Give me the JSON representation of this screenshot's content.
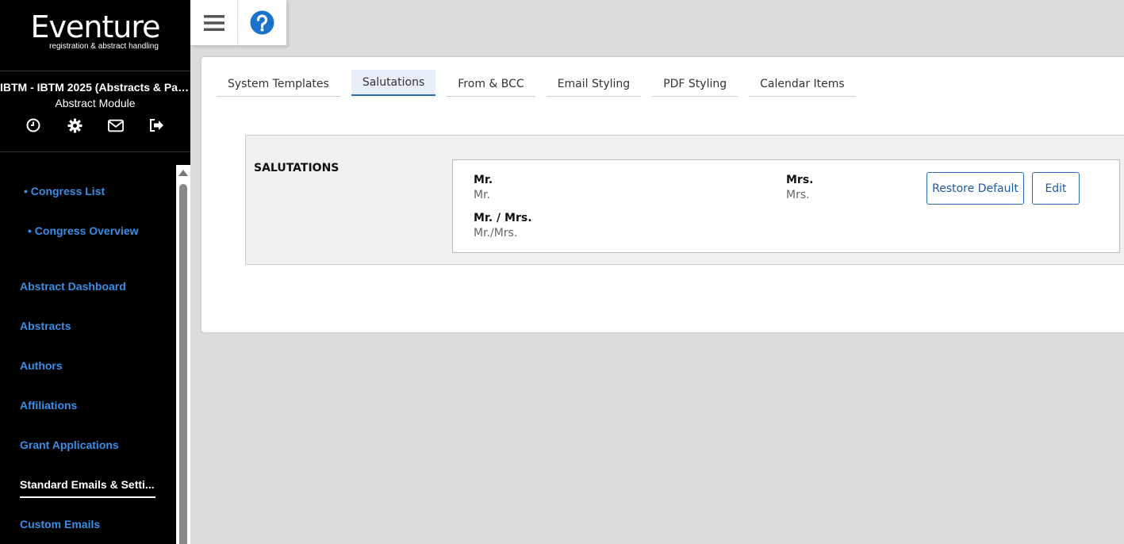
{
  "brand": {
    "name": "Eventure",
    "tagline": "registration & abstract handling"
  },
  "congress": {
    "title": "IBTM - IBTM 2025 (Abstracts & Par...",
    "module": "Abstract Module"
  },
  "sidebar": {
    "icons": [
      "clock-icon",
      "gear-icon",
      "envelope-icon",
      "logout-icon"
    ],
    "items": [
      {
        "label": "• Congress List"
      },
      {
        "label": "• Congress Overview"
      },
      {
        "label": "Abstract Dashboard"
      },
      {
        "label": "Abstracts"
      },
      {
        "label": "Authors"
      },
      {
        "label": "Affiliations"
      },
      {
        "label": "Grant Applications"
      },
      {
        "label": "Standard Emails & Setti..."
      },
      {
        "label": "Custom Emails"
      }
    ]
  },
  "topbar": {
    "icons": [
      "hamburger-menu-icon",
      "help-icon"
    ]
  },
  "tabs": [
    {
      "label": "System Templates"
    },
    {
      "label": "Salutations"
    },
    {
      "label": "From & BCC"
    },
    {
      "label": "Email Styling"
    },
    {
      "label": "PDF Styling"
    },
    {
      "label": "Calendar Items"
    }
  ],
  "active_tab": "Salutations",
  "salutations": {
    "title": "SALUTATIONS",
    "items": [
      {
        "label": "Mr.",
        "value": "Mr."
      },
      {
        "label": "Mrs.",
        "value": "Mrs."
      },
      {
        "label": "Mr. / Mrs.",
        "value": "Mr./Mrs."
      }
    ],
    "restore_label": "Restore Default",
    "edit_label": "Edit"
  },
  "colors": {
    "sidebar_bg": "#000000",
    "link": "#3a8ee6",
    "accent": "#2a6db5",
    "page_bg": "#dcdcdc",
    "help": "#1a73c8"
  }
}
